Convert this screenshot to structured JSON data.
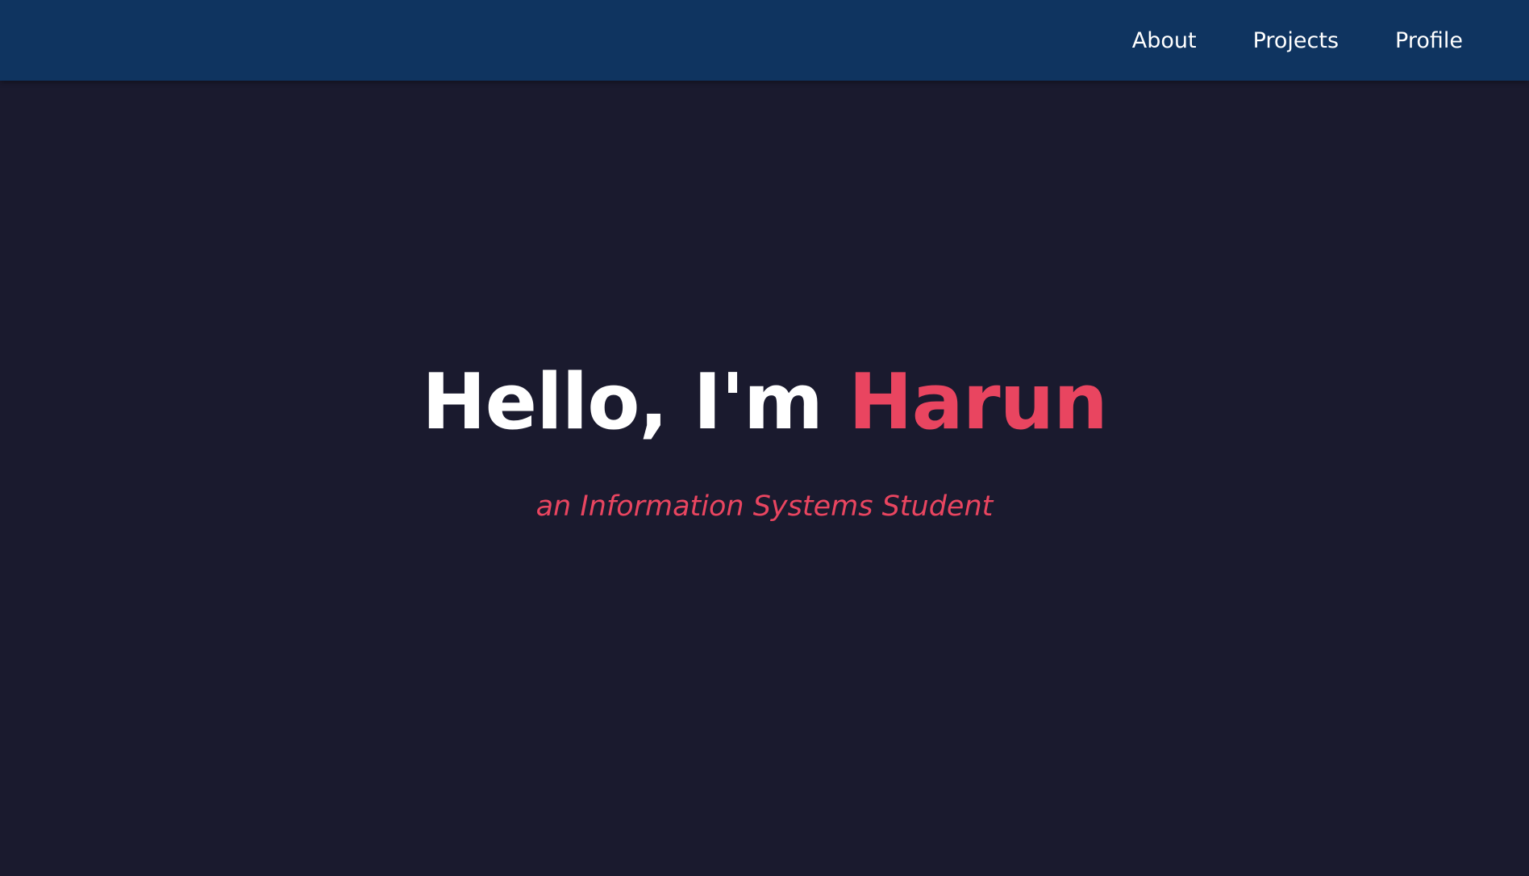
{
  "navbar": {
    "links": [
      {
        "label": "About"
      },
      {
        "label": "Projects"
      },
      {
        "label": "Profile"
      }
    ]
  },
  "hero": {
    "greeting": "Hello, I'm",
    "name": "Harun",
    "subtitle": "an Information Systems Student"
  },
  "colors": {
    "background": "#1a1a2e",
    "navbar": "#0f3460",
    "accent": "#e94560",
    "text": "#ffffff"
  }
}
